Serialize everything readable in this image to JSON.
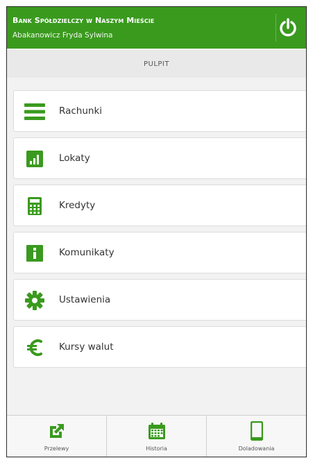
{
  "header": {
    "bank_name": "Bank Spółdzielczy w Naszym Mieście",
    "user_name": "Abakanowicz Fryda Sylwina",
    "logout_icon": "power-icon"
  },
  "page_title": "Pulpit",
  "menu": [
    {
      "label": "Rachunki",
      "icon": "list-icon"
    },
    {
      "label": "Lokaty",
      "icon": "bar-chart-icon"
    },
    {
      "label": "Kredyty",
      "icon": "calculator-icon"
    },
    {
      "label": "Komunikaty",
      "icon": "info-icon"
    },
    {
      "label": "Ustawienia",
      "icon": "gear-icon"
    },
    {
      "label": "Kursy walut",
      "icon": "euro-icon"
    }
  ],
  "bottom_nav": [
    {
      "label": "Przelewy",
      "icon": "external-link-icon"
    },
    {
      "label": "Historia",
      "icon": "calendar-icon"
    },
    {
      "label": "Doladowania",
      "icon": "phone-icon"
    }
  ],
  "colors": {
    "accent": "#3a9a1e",
    "background": "#f2f2f2"
  }
}
